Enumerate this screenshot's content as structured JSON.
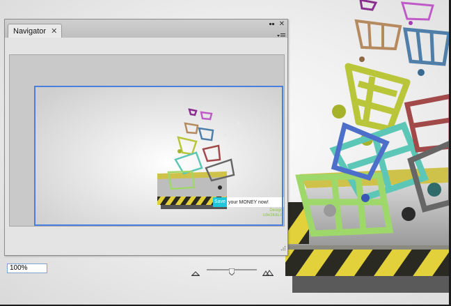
{
  "navigator": {
    "tab_label": "Navigator",
    "zoom_value": "100%",
    "zoom_slider_fraction": 0.5
  },
  "preview": {
    "banner_highlight": "Save",
    "banner_text": "your MONEY now!",
    "credit_line1": "Design",
    "credit_line2": "cdw3ltdu.lt"
  },
  "colors": {
    "view_rect": "#4a7fe0",
    "banner_highlight": "#23c6d8",
    "hazard_yellow": "#e2d13a",
    "hazard_black": "#2a2a22"
  },
  "icons": [
    "close-icon",
    "collapse-icon",
    "panel-menu-icon",
    "zoom-out-icon",
    "zoom-in-icon",
    "resize-grip-icon"
  ]
}
